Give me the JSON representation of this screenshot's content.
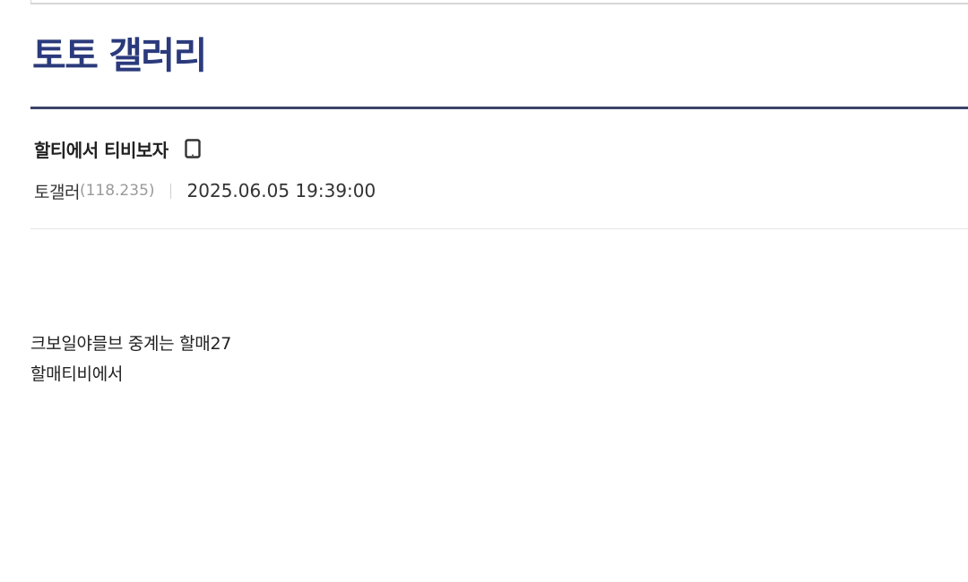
{
  "gallery": {
    "title": "토토 갤러리"
  },
  "post": {
    "title": "할티에서 티비보자",
    "title_icon": "mobile-phone-icon",
    "author": "토갤러",
    "author_ip": "(118.235)",
    "date": "2025.06.05 19:39:00",
    "body_lines": [
      "크보일야믈브 중계는 할매27",
      "할매티비에서"
    ]
  },
  "colors": {
    "title": "#2b3a7c",
    "rule": "#3b4469",
    "muted": "#9a9a9a"
  }
}
